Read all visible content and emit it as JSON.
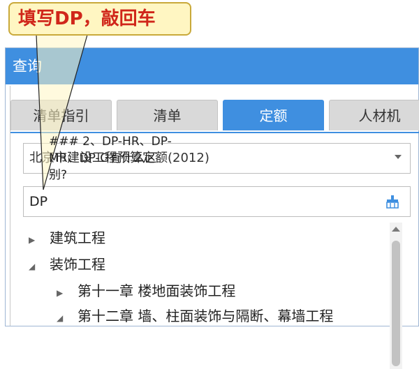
{
  "callout": {
    "text": "填写DP，敲回车"
  },
  "window": {
    "title": "查询"
  },
  "tabs": [
    {
      "label": "清单指引",
      "active": false
    },
    {
      "label": "清单",
      "active": false
    },
    {
      "label": "定额",
      "active": true
    },
    {
      "label": "人材机",
      "active": false
    }
  ],
  "library_select": {
    "value": "北京市建设工程预算定额(2012)"
  },
  "search": {
    "value": "DP"
  },
  "tree": {
    "items": [
      {
        "label": "建筑工程",
        "expanded": false,
        "level": 1
      },
      {
        "label": "装饰工程",
        "expanded": true,
        "level": 1
      },
      {
        "label": "第十一章 楼地面装饰工程",
        "expanded": false,
        "level": 2
      },
      {
        "label": "第十二章 墙、柱面装饰与隔断、幕墙工程",
        "expanded": true,
        "level": 2
      }
    ]
  },
  "overlay_text": {
    "line1": "### 2、DP-HR、DP-",
    "line2": "MR、DP-G有什么区",
    "line3": "别?"
  },
  "colors": {
    "accent": "#3f8fe0",
    "callout_bg": "#fff6c2",
    "callout_text": "#d0261a"
  },
  "icons": {
    "clear": "broom-icon",
    "dropdown": "chevron-down-icon"
  }
}
